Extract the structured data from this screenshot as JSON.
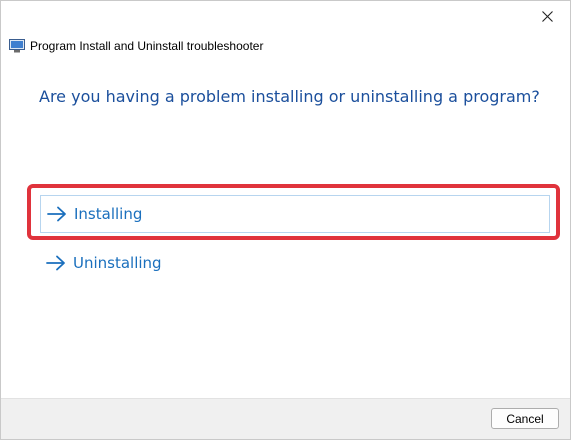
{
  "window": {
    "close_label": "✕"
  },
  "header": {
    "title": "Program Install and Uninstall troubleshooter"
  },
  "main": {
    "question": "Are you having a problem installing or uninstalling a program?",
    "options": [
      {
        "label": "Installing",
        "selected": true
      },
      {
        "label": "Uninstalling",
        "selected": false
      }
    ]
  },
  "footer": {
    "cancel_label": "Cancel"
  },
  "colors": {
    "question_text": "#1b4f9c",
    "option_text": "#1a6fbd",
    "highlight_border": "#e0333c",
    "selected_option_border": "#b7d5ef"
  },
  "icons": {
    "app": "troubleshooter-app-icon",
    "option_arrow": "arrow-right-icon",
    "close": "close-icon"
  }
}
